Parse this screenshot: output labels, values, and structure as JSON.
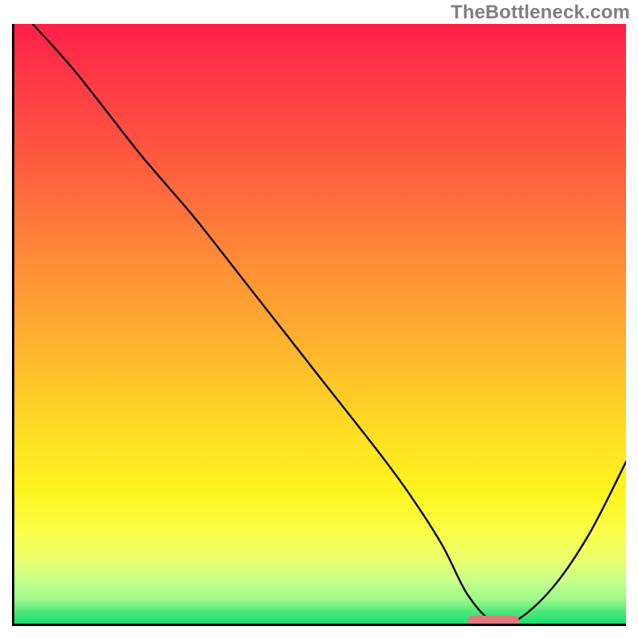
{
  "watermark": "TheBottleneck.com",
  "chart_data": {
    "type": "line",
    "title": "",
    "xlabel": "",
    "ylabel": "",
    "xlim": [
      0,
      100
    ],
    "ylim": [
      0,
      100
    ],
    "grid": false,
    "x": [
      3,
      10,
      20,
      25,
      30,
      40,
      50,
      60,
      65,
      70,
      74,
      78,
      82,
      88,
      94,
      100
    ],
    "values": [
      100,
      92,
      79,
      73,
      67,
      54,
      41,
      28,
      21,
      13,
      5,
      0.5,
      0.5,
      6,
      15,
      27
    ],
    "marker_segment": {
      "x_start": 74,
      "x_end": 82,
      "y": 0.5
    },
    "gradient_stops": [
      {
        "pos": 0,
        "color": "#ff2047"
      },
      {
        "pos": 22,
        "color": "#ff5840"
      },
      {
        "pos": 48,
        "color": "#ffa432"
      },
      {
        "pos": 70,
        "color": "#ffe223"
      },
      {
        "pos": 85,
        "color": "#fbff4b"
      },
      {
        "pos": 96,
        "color": "#9cf98c"
      },
      {
        "pos": 100,
        "color": "#18df72"
      }
    ]
  }
}
